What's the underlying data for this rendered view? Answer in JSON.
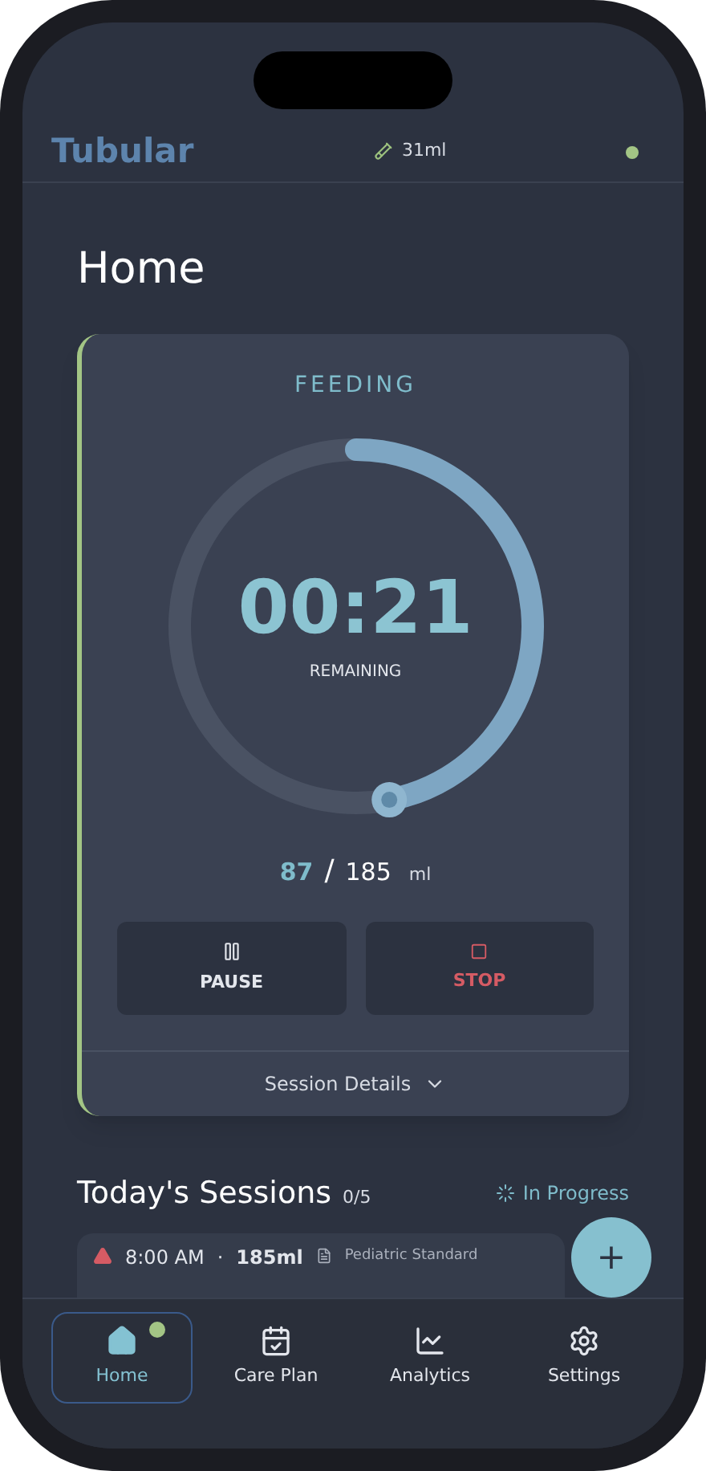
{
  "header": {
    "logo": "Tubular",
    "volume": "31ml",
    "connected": true
  },
  "page_title": "Home",
  "feeding_card": {
    "label": "FEEDING",
    "time": "00:21",
    "time_caption": "REMAINING",
    "level": 0.47,
    "delivered": "87",
    "separator": "/",
    "total": "185",
    "unit": "ml",
    "buttons": [
      {
        "kind": "pause",
        "label": "PAUSE"
      },
      {
        "kind": "stop",
        "label": "STOP"
      }
    ],
    "details_toggle": {
      "label": "Session Details",
      "expanded": false
    }
  },
  "sessions": {
    "title": "Today's Sessions",
    "count": "0/5",
    "status": "In Progress",
    "items": [
      {
        "time": "8:00 AM",
        "separator": "·",
        "volume": "185ml",
        "plan": "Pediatric Standard"
      }
    ]
  },
  "fab": {
    "label": "+"
  },
  "nav": [
    {
      "kind": "home",
      "label": "Home",
      "selected": true,
      "badge": true
    },
    {
      "kind": "calendar",
      "label": "Care Plan",
      "selected": false,
      "badge": false
    },
    {
      "kind": "chart",
      "label": "Analytics",
      "selected": false,
      "badge": false
    },
    {
      "kind": "settings",
      "label": "Settings",
      "selected": false,
      "badge": false
    }
  ]
}
